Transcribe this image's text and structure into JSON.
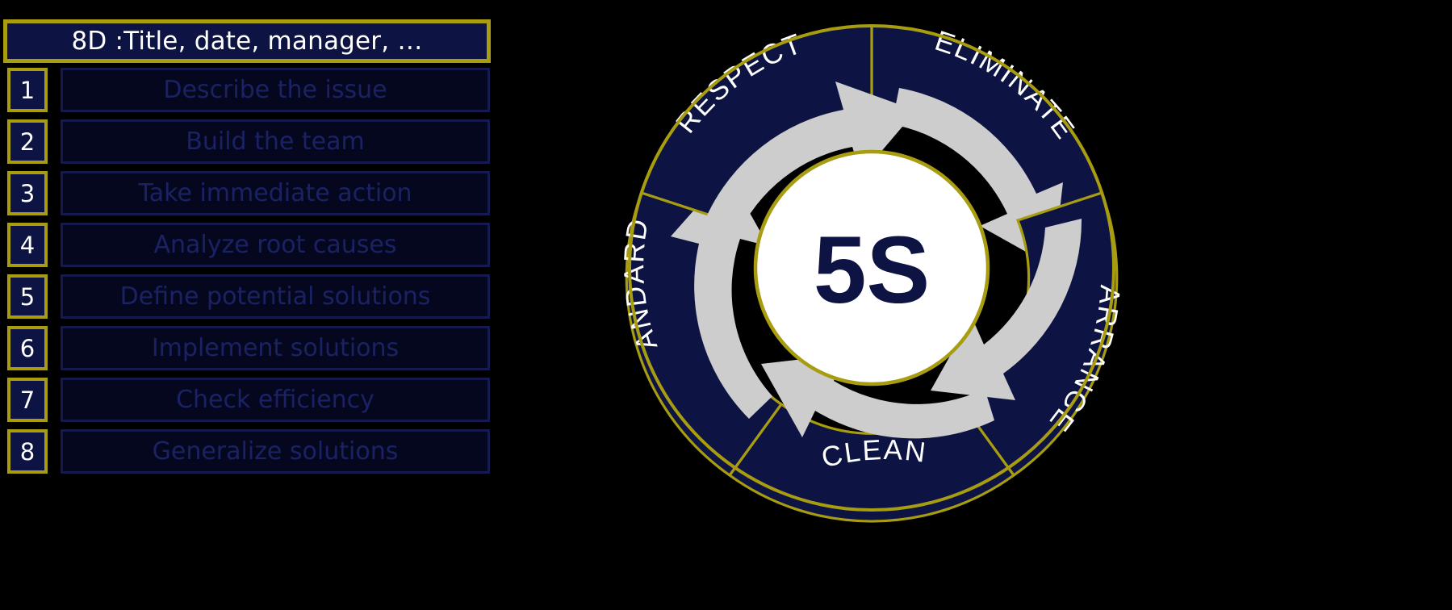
{
  "checklist": {
    "title": "8D :Title, date, manager, …",
    "rows": [
      {
        "num": "1",
        "label": "Describe the issue"
      },
      {
        "num": "2",
        "label": "Build the team"
      },
      {
        "num": "3",
        "label": "Take immediate action"
      },
      {
        "num": "4",
        "label": "Analyze root causes"
      },
      {
        "num": "5",
        "label": "Define potential solutions"
      },
      {
        "num": "6",
        "label": "Implement solutions"
      },
      {
        "num": "7",
        "label": "Check efficiency"
      },
      {
        "num": "8",
        "label": "Generalize solutions"
      }
    ]
  },
  "wheel": {
    "center_label": "5S",
    "segments": [
      {
        "label": "ELIMINATE"
      },
      {
        "label": "ARRANGE"
      },
      {
        "label": "CLEAN"
      },
      {
        "label": "STANDARDIZE"
      },
      {
        "label": "RESPECT"
      }
    ]
  },
  "colors": {
    "background": "#000000",
    "navy": "#0d1342",
    "gold": "#a89c10",
    "arrow_gray": "#cdcdcd",
    "white": "#ffffff",
    "label_navy": "#1a2263"
  }
}
